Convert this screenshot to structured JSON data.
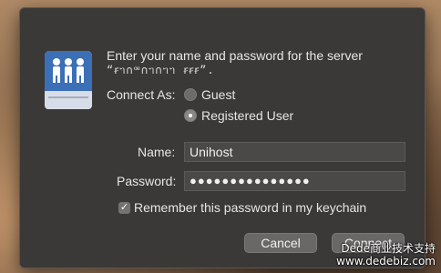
{
  "dialog": {
    "message": "Enter your name and password for the server",
    "server_name": "“ꞧᥐ∩ꟹ∩ᥐ∩ᥐᥐ ꞧꞧꞧ”."
  },
  "connect_as": {
    "label": "Connect As:",
    "options": [
      "Guest",
      "Registered User"
    ],
    "selected": "Registered User"
  },
  "fields": {
    "name_label": "Name:",
    "name_value": "Unihost",
    "password_label": "Password:",
    "password_value": "●●●●●●●●●●●●●●●"
  },
  "remember": {
    "label": "Remember this password in my keychain",
    "checked": true
  },
  "buttons": {
    "cancel": "Cancel",
    "connect": "Connect"
  },
  "watermark": {
    "line1": "Dede商业技术支持",
    "line2": "www.dedebiz.com"
  },
  "icons": {
    "server": "server-users-icon",
    "check": "checkmark-icon"
  }
}
